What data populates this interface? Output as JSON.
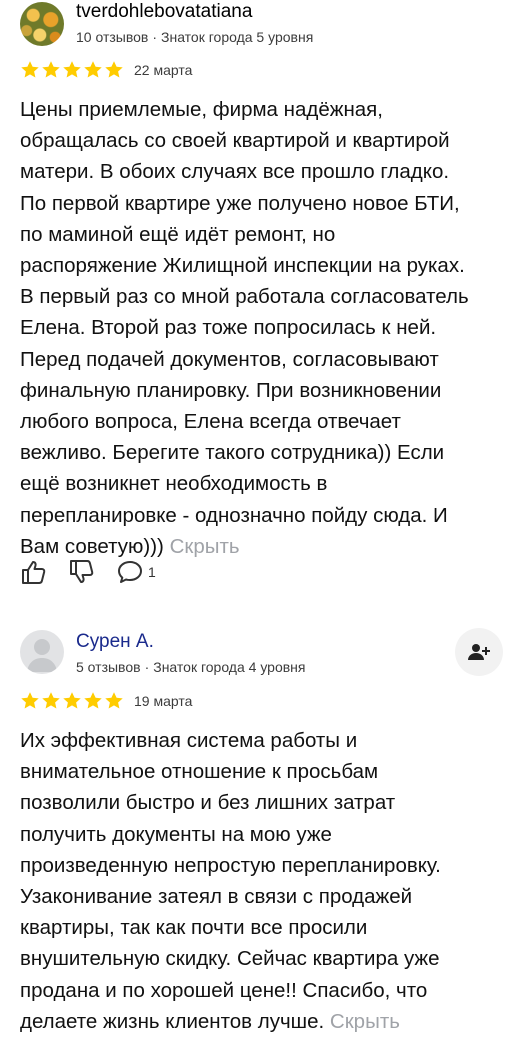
{
  "reviews": [
    {
      "author": "tverdohlebovatatiana",
      "reviews_count": "10 отзывов",
      "level": "Знаток города 5 уровня",
      "rating": 5,
      "date": "22 марта",
      "text": "Цены приемлемые, фирма надёжная,\nобращалась со своей квартирой и квартирой\nматери. В обоих случаях все прошло гладко.\nПо первой квартире уже получено новое БТИ,\nпо маминой ещё идёт ремонт, но\nраспоряжение Жилищной инспекции на руках.\nВ первый раз со мной работала согласователь\nЕлена. Второй раз тоже попросилась к ней.\nПеред подачей документов, согласовывают\nфинальную планировку. При возникновении\nлюбого вопроса, Елена всегда отвечает\nвежливо. Берегите такого сотрудника)) Если\nещё возникнет необходимость в\nперепланировке - однозначно пойду сюда. И\nВам советую)))",
      "hide_label": "Скрыть",
      "comment_count": "1",
      "icons": [
        "like-icon",
        "dislike-icon",
        "comment-icon"
      ]
    },
    {
      "author": "Сурен А.",
      "reviews_count": "5 отзывов",
      "level": "Знаток города 4 уровня",
      "rating": 5,
      "date": "19 марта",
      "text": "Их эффективная система работы и\nвнимательное отношение к просьбам\nпозволили быстро и без лишних затрат\nполучить документы на мою уже\nпроизведенную непростую перепланировку.\nУзаконивание затеял в связи с продажей\nквартиры, так как почти все просили\nвнушительную скидку. Сейчас квартира уже\nпродана и по хорошей цене!! Спасибо, что\nделаете жизнь клиентов лучше.",
      "hide_label": "Скрыть",
      "icons": [
        "subscribe-icon"
      ]
    }
  ],
  "separator": "·",
  "colors": {
    "star": "#fc0",
    "link": "#1a2a8c",
    "muted": "#a0a3a8"
  }
}
